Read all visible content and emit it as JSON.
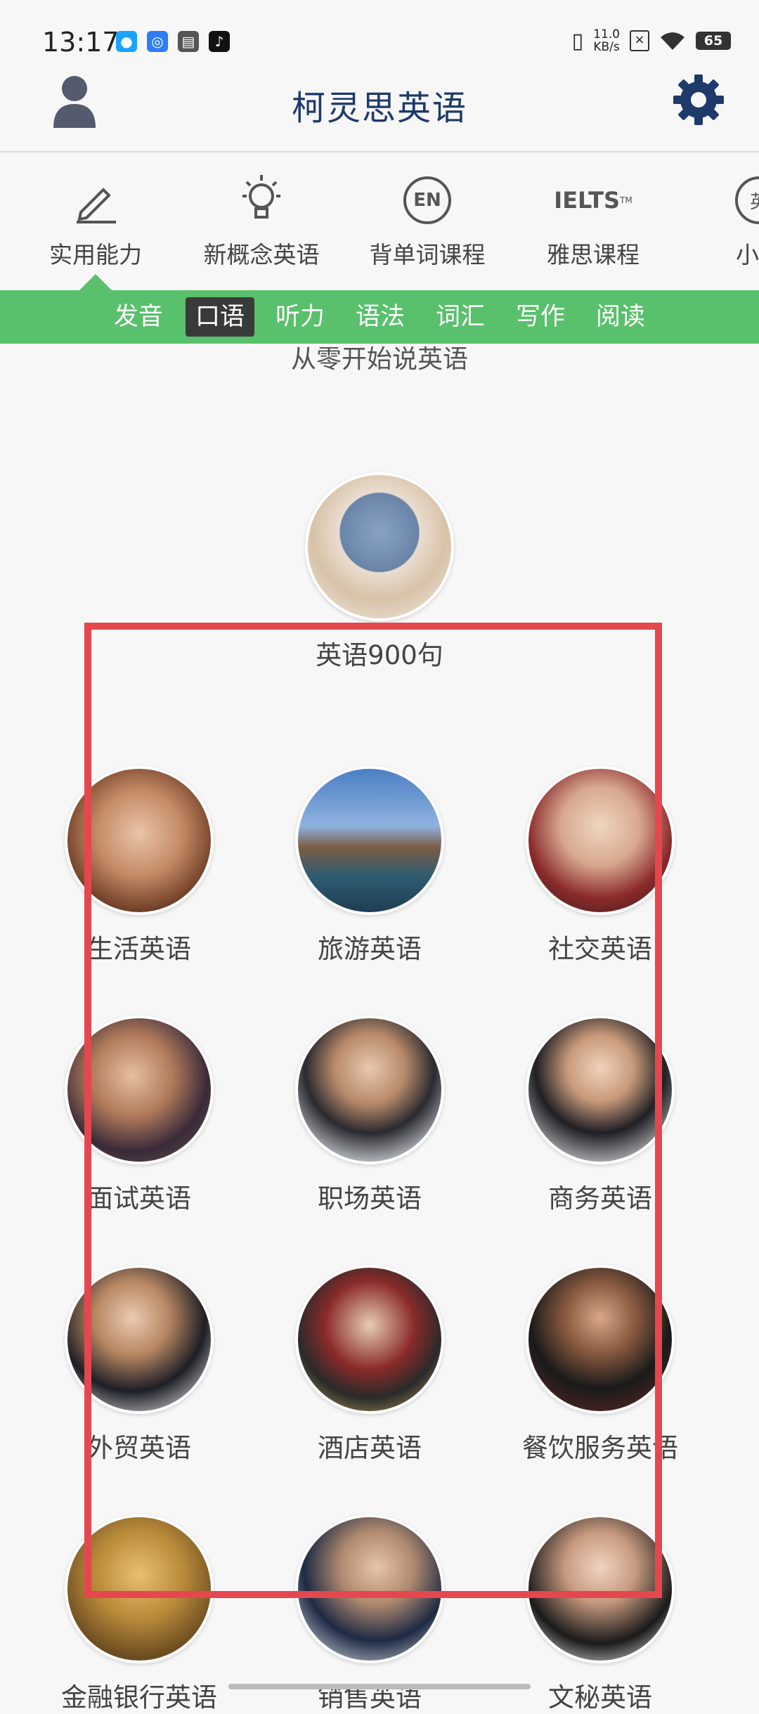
{
  "status_bar": {
    "time": "13:17",
    "speed_value": "11.0",
    "speed_unit": "KB/s",
    "battery": "65"
  },
  "header": {
    "title": "柯灵思英语"
  },
  "categories": [
    {
      "label": "实用能力",
      "icon": "pencil-icon"
    },
    {
      "label": "新概念英语",
      "icon": "lightbulb-icon"
    },
    {
      "label": "背单词课程",
      "icon": "en-icon",
      "icon_text": "EN"
    },
    {
      "label": "雅思课程",
      "icon": "ielts-icon",
      "icon_text": "IELTS",
      "icon_tm": "TM"
    },
    {
      "label": "小学",
      "icon": "primary-icon",
      "icon_text": "英"
    }
  ],
  "subtabs": [
    "发音",
    "口语",
    "听力",
    "语法",
    "词汇",
    "写作",
    "阅读"
  ],
  "active_subtab": "口语",
  "section_title": "从零开始说英语",
  "featured": {
    "label": "英语900句"
  },
  "grid": [
    {
      "label": "生活英语"
    },
    {
      "label": "旅游英语"
    },
    {
      "label": "社交英语"
    },
    {
      "label": "面试英语"
    },
    {
      "label": "职场英语"
    },
    {
      "label": "商务英语"
    },
    {
      "label": "外贸英语"
    },
    {
      "label": "酒店英语"
    },
    {
      "label": "餐饮服务英语"
    },
    {
      "label": "金融银行英语"
    },
    {
      "label": "销售英语"
    },
    {
      "label": "文秘英语"
    }
  ],
  "colors": {
    "accent_green": "#59c06c",
    "title_blue": "#1e3a6b",
    "highlight_red": "#e5474f"
  }
}
